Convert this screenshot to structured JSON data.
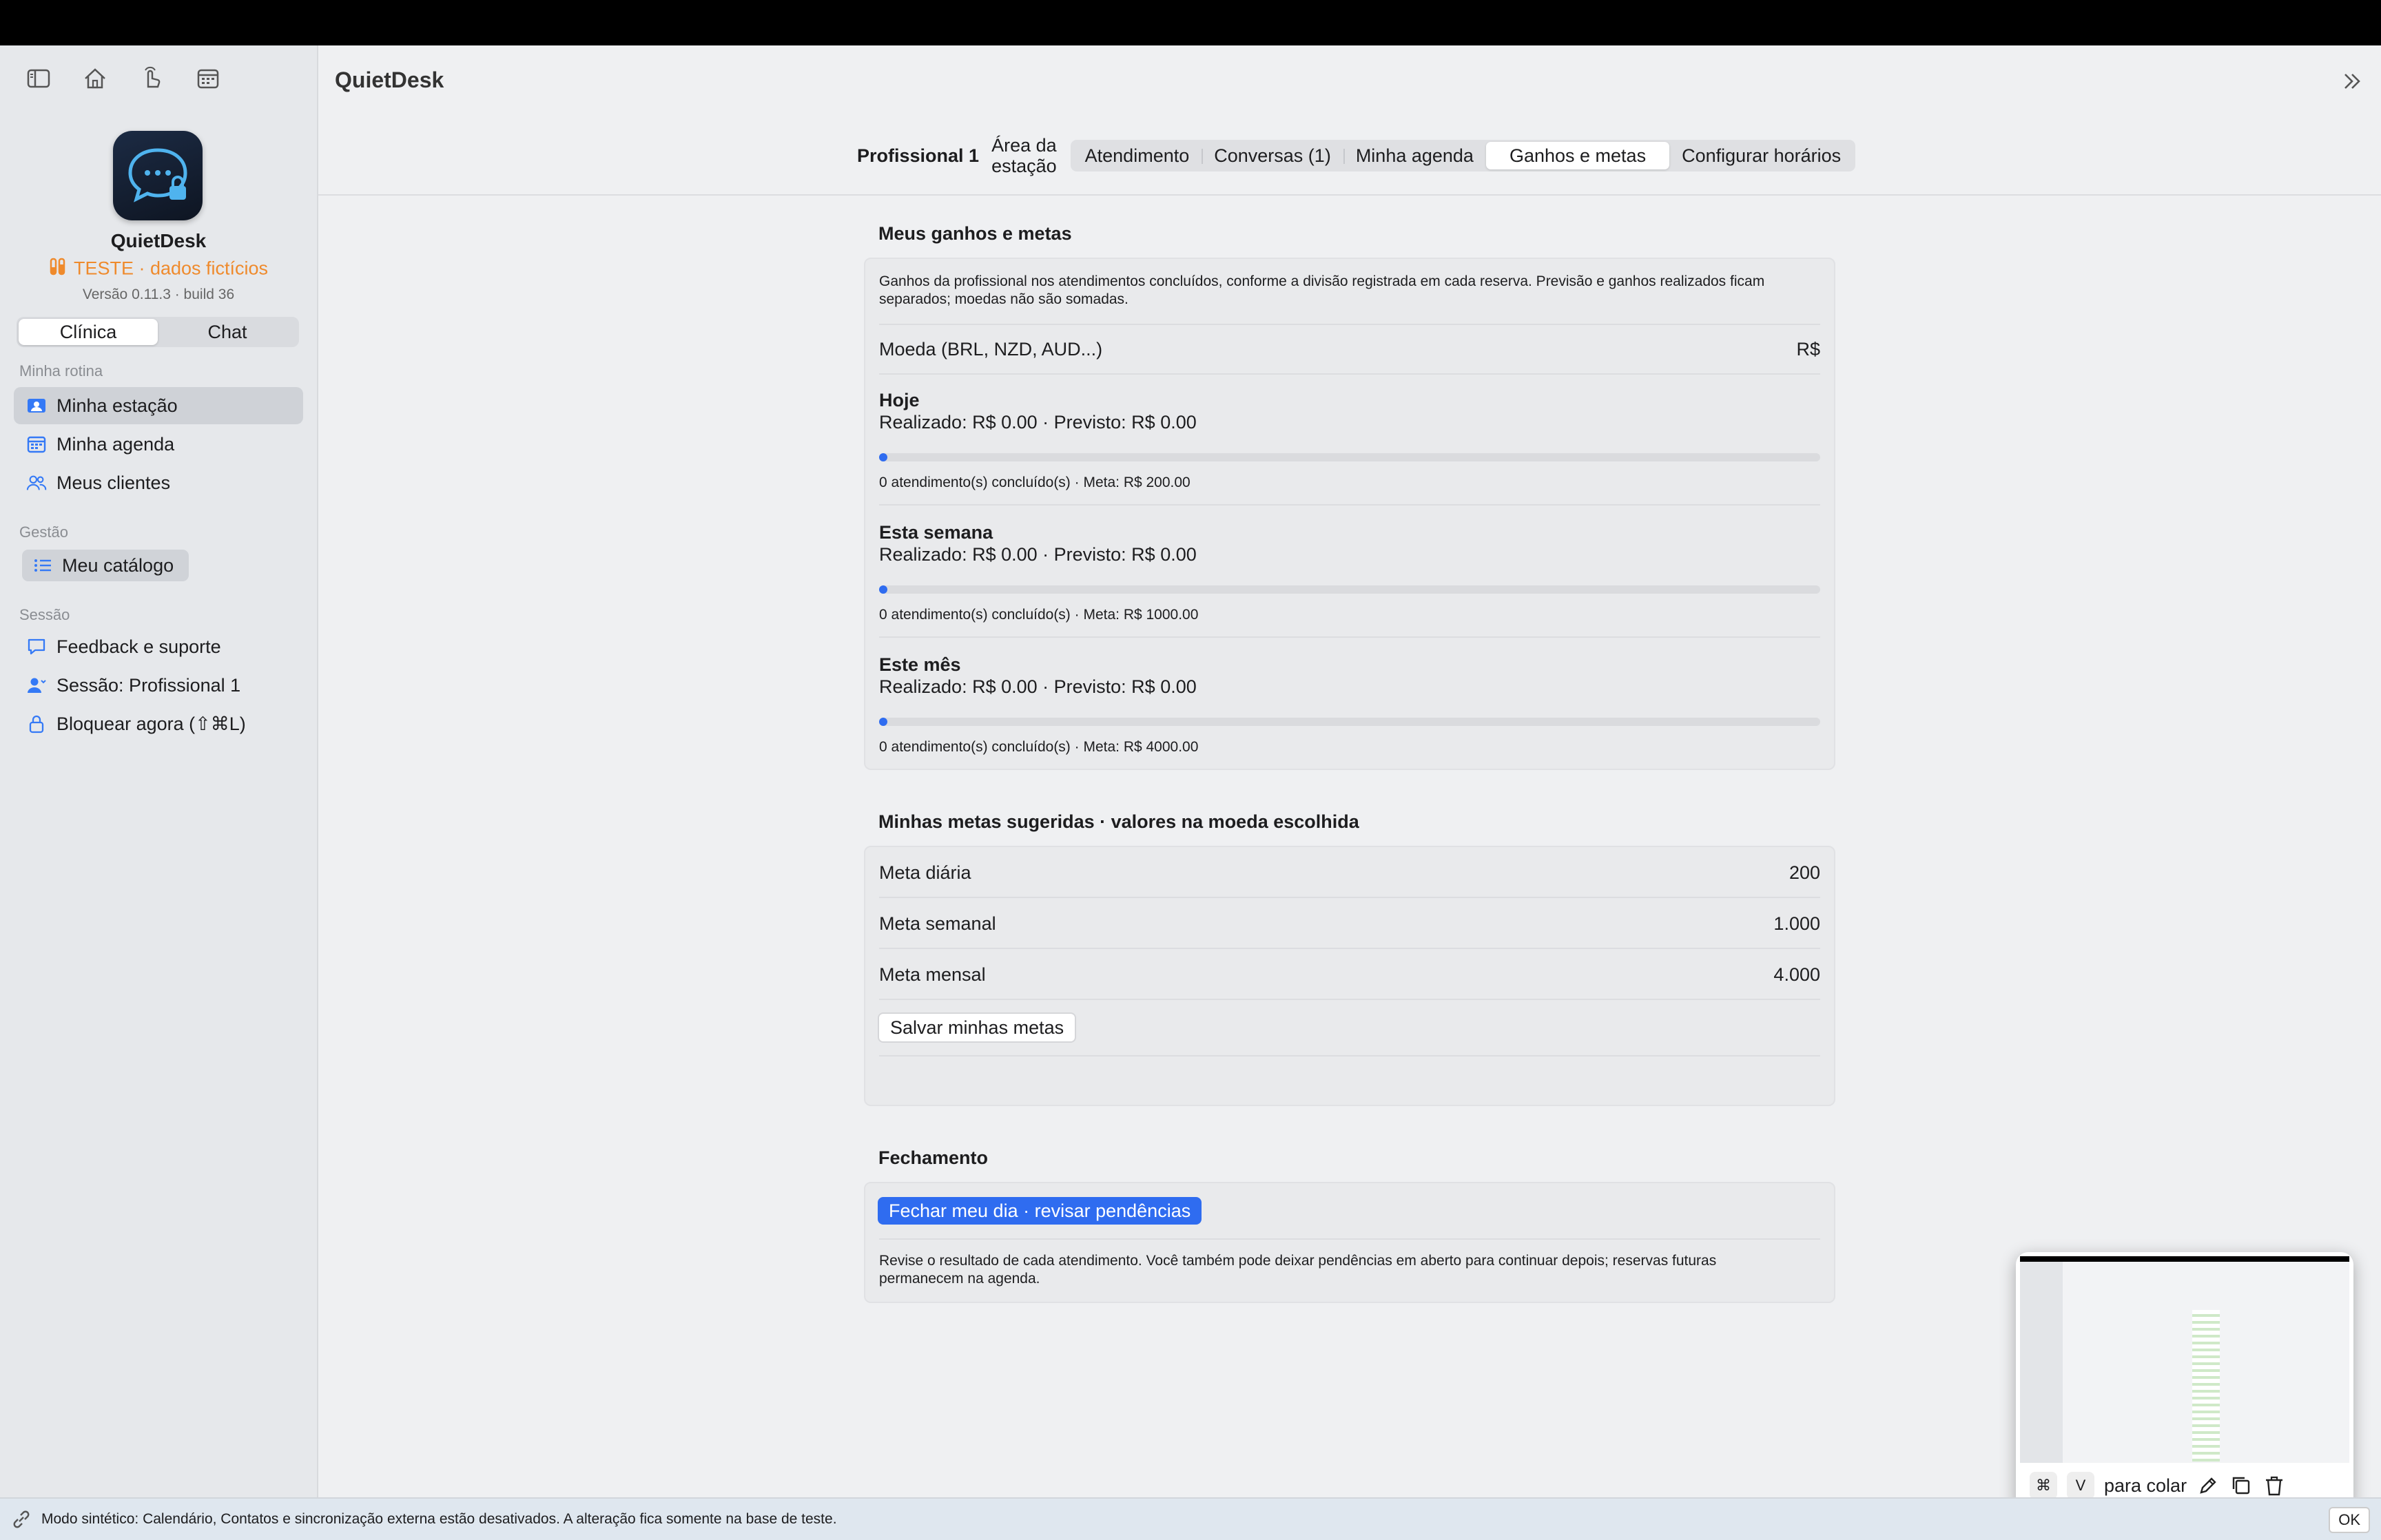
{
  "app": {
    "name": "QuietDesk",
    "test_badge": "TESTE · dados fictícios",
    "version": "Versão 0.11.3 · build 36"
  },
  "sidebar": {
    "segments": [
      "Clínica",
      "Chat"
    ],
    "sections": {
      "rotina": "Minha rotina",
      "gestao": "Gestão",
      "sessao": "Sessão"
    },
    "rotina_items": [
      {
        "label": "Minha estação",
        "icon": "person-card-icon"
      },
      {
        "label": "Minha agenda",
        "icon": "calendar-icon"
      },
      {
        "label": "Meus clientes",
        "icon": "people-icon"
      }
    ],
    "gestao_item": {
      "label": "Meu catálogo",
      "icon": "list-icon"
    },
    "sessao_items": [
      {
        "label": "Feedback e suporte",
        "icon": "speech-bubble-icon"
      },
      {
        "label": "Sessão: Profissional 1",
        "icon": "person-icon"
      },
      {
        "label": "Bloquear agora (⇧⌘L)",
        "icon": "lock-icon"
      }
    ]
  },
  "header": {
    "title": "QuietDesk",
    "profile": "Profissional 1",
    "area_line1": "Área da",
    "area_line2": "estação",
    "tabs": [
      "Atendimento",
      "Conversas (1)",
      "Minha agenda",
      "Ganhos e metas",
      "Configurar horários"
    ],
    "active_tab": "Ganhos e metas"
  },
  "earnings": {
    "title": "Meus ganhos e metas",
    "description_line1": "Ganhos da profissional nos atendimentos concluídos, conforme a divisão registrada em cada reserva. Previsão e ganhos realizados ficam",
    "description_line2": "separados; moedas não são somadas.",
    "currency_label": "Moeda (BRL, NZD, AUD...)",
    "currency_value": "R$",
    "periods": [
      {
        "title": "Hoje",
        "summary": "Realizado: R$ 0.00 · Previsto: R$ 0.00",
        "progress": 0,
        "footer": "0 atendimento(s) concluído(s) · Meta: R$ 200.00"
      },
      {
        "title": "Esta semana",
        "summary": "Realizado: R$ 0.00 · Previsto: R$ 0.00",
        "progress": 0,
        "footer": "0 atendimento(s) concluído(s) · Meta: R$ 1000.00"
      },
      {
        "title": "Este mês",
        "summary": "Realizado: R$ 0.00 · Previsto: R$ 0.00",
        "progress": 0,
        "footer": "0 atendimento(s) concluído(s) · Meta: R$ 4000.00"
      }
    ]
  },
  "goals": {
    "title": "Minhas metas sugeridas · valores na moeda escolhida",
    "rows": [
      {
        "label": "Meta diária",
        "value": "200"
      },
      {
        "label": "Meta semanal",
        "value": "1.000"
      },
      {
        "label": "Meta mensal",
        "value": "4.000"
      }
    ],
    "save_button": "Salvar minhas metas"
  },
  "closing": {
    "title": "Fechamento",
    "button": "Fechar meu dia · revisar pendências",
    "note_line1": "Revise o resultado de cada atendimento. Você também pode deixar pendências em aberto para continuar depois; reservas futuras",
    "note_line2": "permanecem na agenda."
  },
  "statusbar": {
    "text": "Modo sintético: Calendário, Contatos e sincronização externa estão desativados. A alteração fica somente na base de teste.",
    "ok": "OK"
  },
  "screenshot_popup": {
    "key1": "⌘",
    "key2": "V",
    "label": "para colar"
  },
  "colors": {
    "accent": "#2f6cf0",
    "test_badge": "#ef8a2c",
    "sidebar_bg": "#e6e8eb",
    "main_bg": "#eff0f2"
  }
}
